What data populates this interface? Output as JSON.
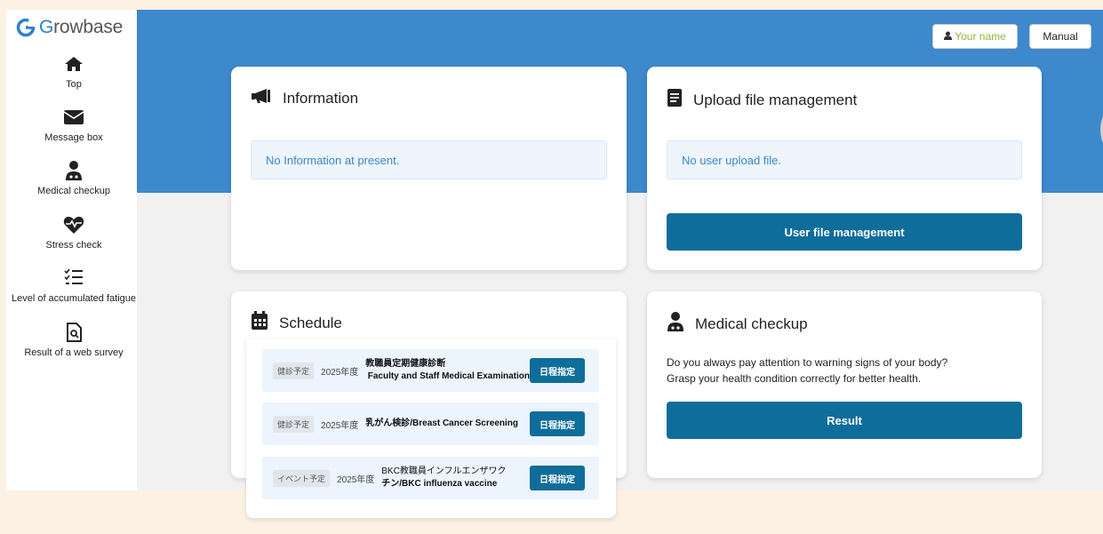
{
  "app": {
    "logo_prefix": "G",
    "logo_suffix": "rowbase"
  },
  "sidebar": {
    "items": [
      {
        "label": "Top",
        "icon": "home-icon"
      },
      {
        "label": "Message box",
        "icon": "envelope-icon"
      },
      {
        "label": "Medical checkup",
        "icon": "doctor-icon"
      },
      {
        "label": "Stress check",
        "icon": "heartbeat-icon"
      },
      {
        "label": "Level of accumulated fatigue",
        "icon": "checklist-icon"
      },
      {
        "label": "Result of a web survey",
        "icon": "search-document-icon"
      }
    ]
  },
  "header": {
    "user_label": "Your name",
    "manual_label": "Manual"
  },
  "information": {
    "title": "Information",
    "notice": "No Information at present."
  },
  "upload": {
    "title": "Upload file management",
    "notice": "No user upload file.",
    "button_label": "User file management"
  },
  "schedule": {
    "title": "Schedule",
    "items": [
      {
        "tag": "健診予定",
        "year": "2025年度",
        "title_line1": "教職員定期健康診断",
        "title_line2": "Faculty and Staff Medical Examination",
        "button": "日程指定"
      },
      {
        "tag": "健診予定",
        "year": "2025年度",
        "title_line1": "乳がん検診/Breast Cancer Screening",
        "title_line2": "",
        "button": "日程指定"
      },
      {
        "tag": "イベント予定",
        "year": "2025年度",
        "title_line1": "BKC教職員インフルエンザワク",
        "title_line2": "チン/BKC influenza vaccine",
        "button": "日程指定"
      }
    ]
  },
  "medical": {
    "title": "Medical checkup",
    "desc_line1": "Do you always pay attention to warning signs of your body?",
    "desc_line2": "Grasp your health condition correctly for better health.",
    "button_label": "Result"
  },
  "colors": {
    "banner": "#3e88cc",
    "button": "#0e6d9a",
    "notice_text": "#3a87c8",
    "user_label": "#8fb83a"
  }
}
